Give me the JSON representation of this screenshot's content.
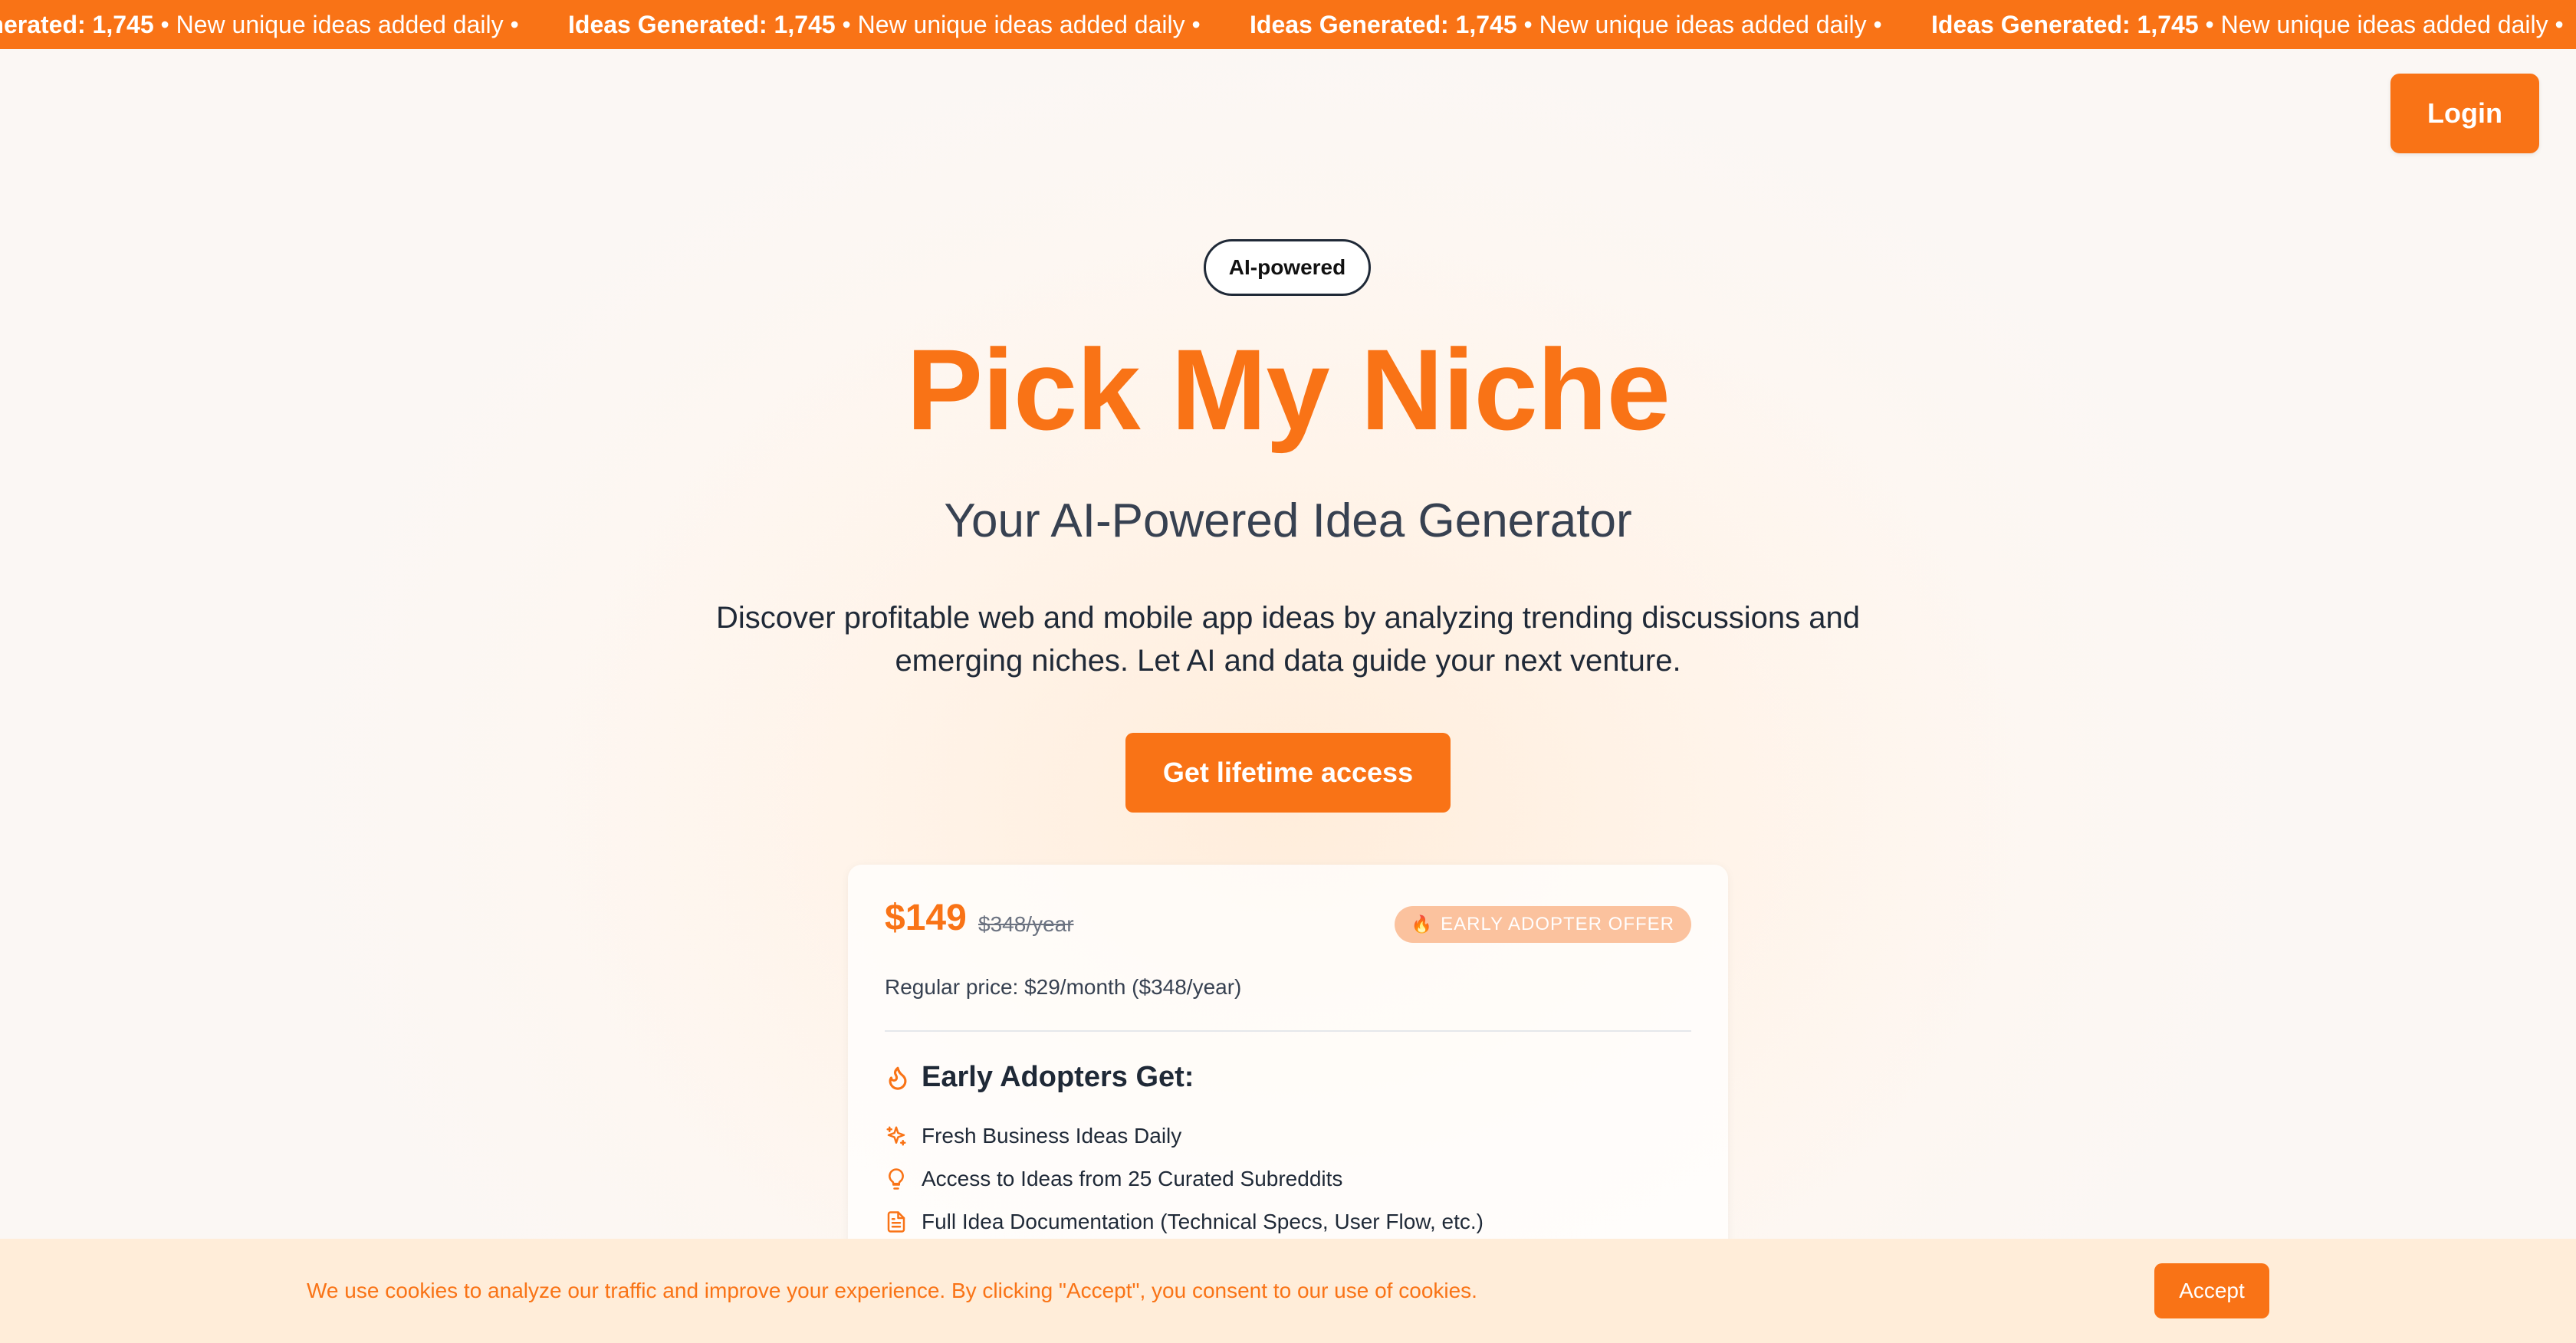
{
  "ticker": {
    "label": "Ideas Generated: 1,745",
    "text": " • New unique ideas added daily •"
  },
  "header": {
    "login_label": "Login"
  },
  "hero": {
    "badge": "AI-powered",
    "title": "Pick My Niche",
    "subtitle": "Your AI-Powered Idea Generator",
    "description": "Discover profitable web and mobile app ideas by analyzing trending discussions and emerging niches. Let AI and data guide your next venture.",
    "cta_label": "Get lifetime access"
  },
  "pricing": {
    "price": "$149",
    "old_price": "$348/year",
    "offer_badge": "EARLY ADOPTER OFFER",
    "regular_price": "Regular price: $29/month ($348/year)",
    "section_title": "Early Adopters Get:",
    "features": [
      {
        "icon": "sparkles-icon",
        "label": "Fresh Business Ideas Daily"
      },
      {
        "icon": "lightbulb-icon",
        "label": "Access to Ideas from 25 Curated Subreddits"
      },
      {
        "icon": "document-icon",
        "label": "Full Idea Documentation (Technical Specs, User Flow, etc.)"
      }
    ]
  },
  "cookie": {
    "text": "We use cookies to analyze our traffic and improve your experience. By clicking \"Accept\", you consent to our use of cookies.",
    "accept_label": "Accept"
  },
  "colors": {
    "accent": "#f97316",
    "text_dark": "#1f2937",
    "cookie_bg": "#ffedd9"
  }
}
